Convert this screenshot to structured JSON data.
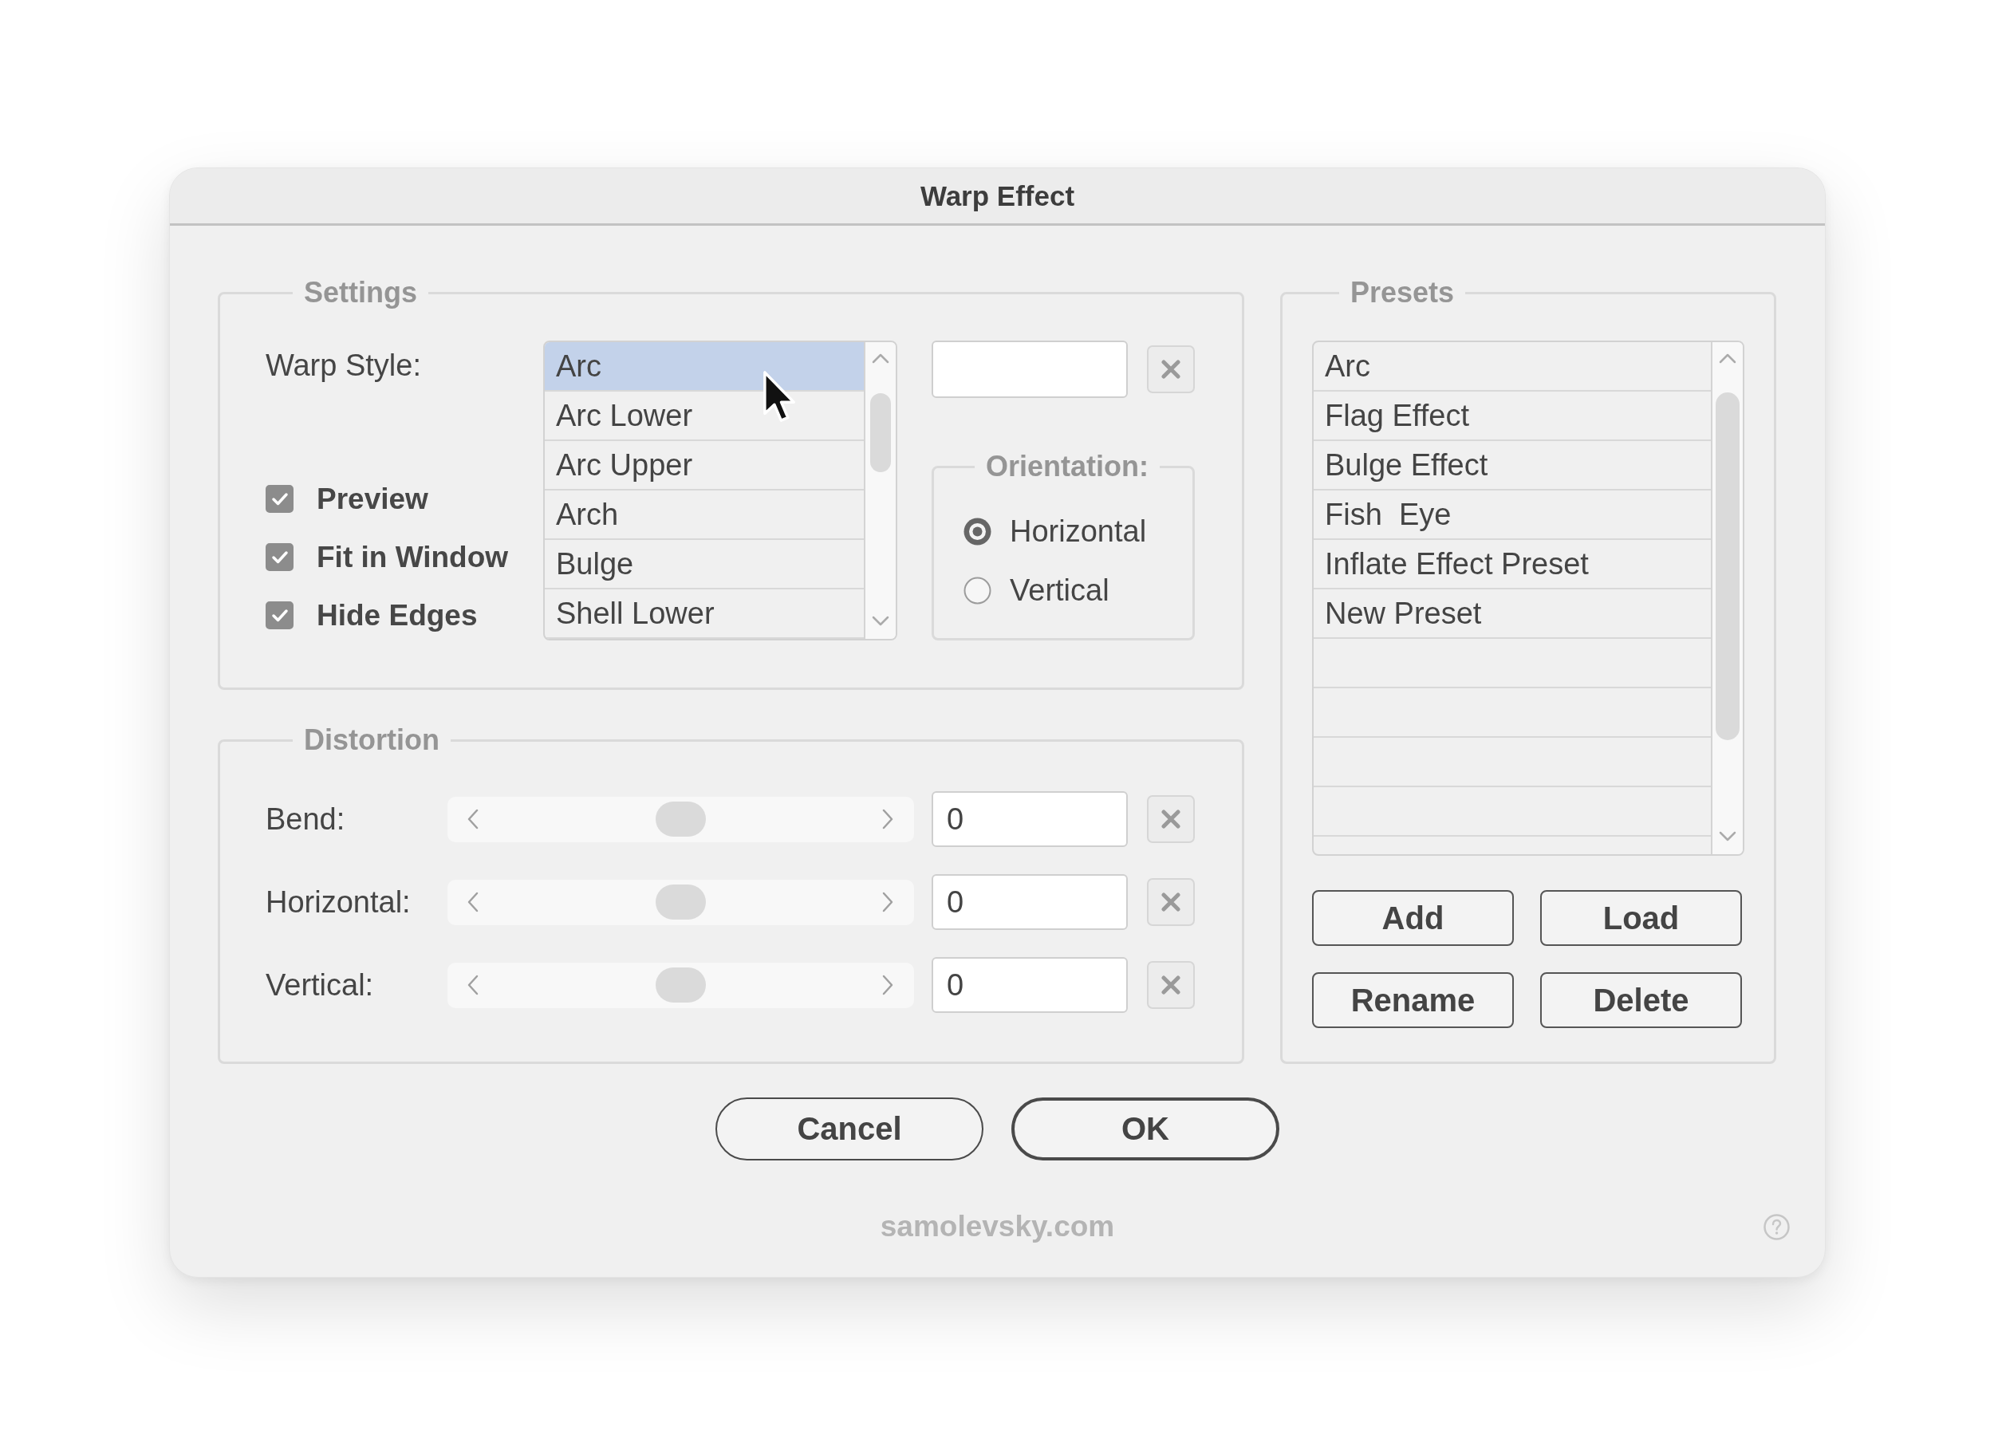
{
  "window": {
    "title": "Warp Effect"
  },
  "settings": {
    "legend": "Settings",
    "warp_style": {
      "label": "Warp Style:",
      "items": [
        {
          "label": "Arc",
          "selected": true
        },
        {
          "label": "Arc Lower",
          "selected": false
        },
        {
          "label": "Arc Upper",
          "selected": false
        },
        {
          "label": "Arch",
          "selected": false
        },
        {
          "label": "Bulge",
          "selected": false
        },
        {
          "label": "Shell Lower",
          "selected": false
        }
      ]
    },
    "options": [
      {
        "label": "Preview",
        "checked": true
      },
      {
        "label": "Fit in Window",
        "checked": true
      },
      {
        "label": "Hide Edges",
        "checked": true
      }
    ],
    "orientation": {
      "legend": "Orientation:",
      "options": [
        {
          "label": "Horizontal",
          "selected": true
        },
        {
          "label": "Vertical",
          "selected": false
        }
      ]
    }
  },
  "distortion": {
    "legend": "Distortion",
    "sliders": [
      {
        "label": "Bend:",
        "level": 0.5,
        "value": "0"
      },
      {
        "label": "Horizontal:",
        "level": 0.5,
        "value": "0"
      },
      {
        "label": "Vertical:",
        "level": 0.5,
        "value": "0"
      }
    ]
  },
  "presets": {
    "legend": "Presets",
    "items": [
      {
        "label": "Arc",
        "selected": false
      },
      {
        "label": "Flag Effect",
        "selected": false
      },
      {
        "label": "Bulge Effect",
        "selected": false
      },
      {
        "label": "Fish  Eye",
        "selected": false
      },
      {
        "label": "Inflate Effect Preset",
        "selected": false
      },
      {
        "label": "New Preset",
        "selected": false
      }
    ],
    "buttons": [
      "Add",
      "Load",
      "Rename",
      "Delete"
    ]
  },
  "buttons": [
    {
      "label": "Cancel",
      "kind": "cancel"
    },
    {
      "label": "OK",
      "kind": "confirm"
    }
  ],
  "footer": {
    "text": "samolevsky.com"
  }
}
